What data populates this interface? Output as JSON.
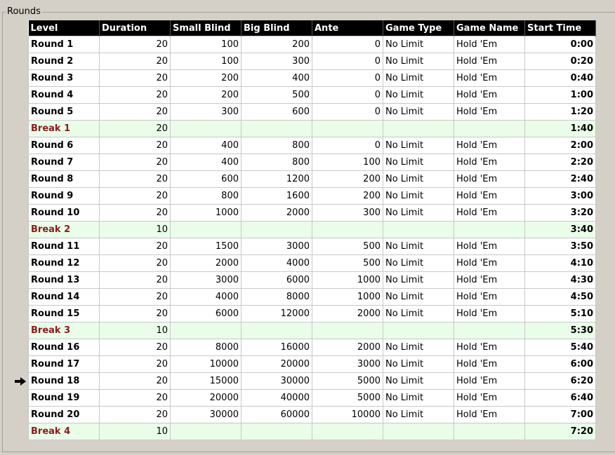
{
  "group": {
    "title": "Rounds"
  },
  "current_index": 20,
  "table": {
    "headers": [
      "Level",
      "Duration",
      "Small Blind",
      "Big Blind",
      "Ante",
      "Game Type",
      "Game Name",
      "Start Time"
    ],
    "rows": [
      {
        "break": false,
        "cells": [
          "Round 1",
          "20",
          "100",
          "200",
          "0",
          "No Limit",
          "Hold 'Em",
          "0:00"
        ]
      },
      {
        "break": false,
        "cells": [
          "Round 2",
          "20",
          "100",
          "300",
          "0",
          "No Limit",
          "Hold 'Em",
          "0:20"
        ]
      },
      {
        "break": false,
        "cells": [
          "Round 3",
          "20",
          "200",
          "400",
          "0",
          "No Limit",
          "Hold 'Em",
          "0:40"
        ]
      },
      {
        "break": false,
        "cells": [
          "Round 4",
          "20",
          "200",
          "500",
          "0",
          "No Limit",
          "Hold 'Em",
          "1:00"
        ]
      },
      {
        "break": false,
        "cells": [
          "Round 5",
          "20",
          "300",
          "600",
          "0",
          "No Limit",
          "Hold 'Em",
          "1:20"
        ]
      },
      {
        "break": true,
        "cells": [
          "Break 1",
          "20",
          "",
          "",
          "",
          "",
          "",
          "1:40"
        ]
      },
      {
        "break": false,
        "cells": [
          "Round 6",
          "20",
          "400",
          "800",
          "0",
          "No Limit",
          "Hold 'Em",
          "2:00"
        ]
      },
      {
        "break": false,
        "cells": [
          "Round 7",
          "20",
          "400",
          "800",
          "100",
          "No Limit",
          "Hold 'Em",
          "2:20"
        ]
      },
      {
        "break": false,
        "cells": [
          "Round 8",
          "20",
          "600",
          "1200",
          "200",
          "No Limit",
          "Hold 'Em",
          "2:40"
        ]
      },
      {
        "break": false,
        "cells": [
          "Round 9",
          "20",
          "800",
          "1600",
          "200",
          "No Limit",
          "Hold 'Em",
          "3:00"
        ]
      },
      {
        "break": false,
        "cells": [
          "Round 10",
          "20",
          "1000",
          "2000",
          "300",
          "No Limit",
          "Hold 'Em",
          "3:20"
        ]
      },
      {
        "break": true,
        "cells": [
          "Break 2",
          "10",
          "",
          "",
          "",
          "",
          "",
          "3:40"
        ]
      },
      {
        "break": false,
        "cells": [
          "Round 11",
          "20",
          "1500",
          "3000",
          "500",
          "No Limit",
          "Hold 'Em",
          "3:50"
        ]
      },
      {
        "break": false,
        "cells": [
          "Round 12",
          "20",
          "2000",
          "4000",
          "500",
          "No Limit",
          "Hold 'Em",
          "4:10"
        ]
      },
      {
        "break": false,
        "cells": [
          "Round 13",
          "20",
          "3000",
          "6000",
          "1000",
          "No Limit",
          "Hold 'Em",
          "4:30"
        ]
      },
      {
        "break": false,
        "cells": [
          "Round 14",
          "20",
          "4000",
          "8000",
          "1000",
          "No Limit",
          "Hold 'Em",
          "4:50"
        ]
      },
      {
        "break": false,
        "cells": [
          "Round 15",
          "20",
          "6000",
          "12000",
          "2000",
          "No Limit",
          "Hold 'Em",
          "5:10"
        ]
      },
      {
        "break": true,
        "cells": [
          "Break 3",
          "10",
          "",
          "",
          "",
          "",
          "",
          "5:30"
        ]
      },
      {
        "break": false,
        "cells": [
          "Round 16",
          "20",
          "8000",
          "16000",
          "2000",
          "No Limit",
          "Hold 'Em",
          "5:40"
        ]
      },
      {
        "break": false,
        "cells": [
          "Round 17",
          "20",
          "10000",
          "20000",
          "3000",
          "No Limit",
          "Hold 'Em",
          "6:00"
        ]
      },
      {
        "break": false,
        "cells": [
          "Round 18",
          "20",
          "15000",
          "30000",
          "5000",
          "No Limit",
          "Hold 'Em",
          "6:20"
        ]
      },
      {
        "break": false,
        "cells": [
          "Round 19",
          "20",
          "20000",
          "40000",
          "5000",
          "No Limit",
          "Hold 'Em",
          "6:40"
        ]
      },
      {
        "break": false,
        "cells": [
          "Round 20",
          "20",
          "30000",
          "60000",
          "10000",
          "No Limit",
          "Hold 'Em",
          "7:00"
        ]
      },
      {
        "break": true,
        "cells": [
          "Break 4",
          "10",
          "",
          "",
          "",
          "",
          "",
          "7:20"
        ]
      }
    ]
  },
  "colors": {
    "break_bg": "#e9fde9",
    "break_text": "#8b1a1a",
    "header_bg": "#000000"
  },
  "icons": {
    "current_row": "right-arrow-icon"
  }
}
